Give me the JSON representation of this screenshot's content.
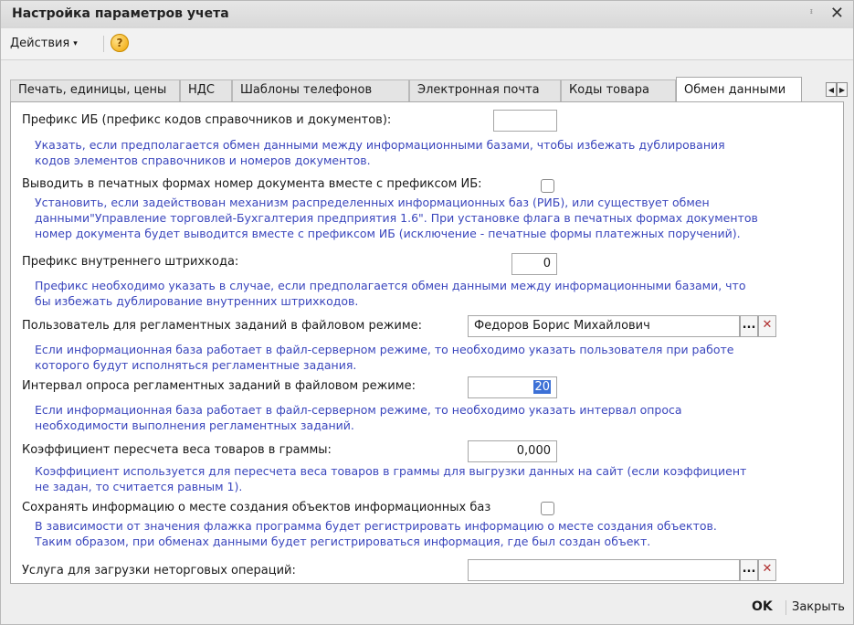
{
  "window": {
    "title": "Настройка параметров учета",
    "pin_glyph": "ᵻ",
    "close_glyph": "✕"
  },
  "menu": {
    "actions_label": "Действия",
    "actions_caret": "▾",
    "help_glyph": "?"
  },
  "tabs": [
    {
      "label": "Печать, единицы, цены",
      "active": false
    },
    {
      "label": "НДС",
      "active": false
    },
    {
      "label": "Шаблоны телефонов",
      "active": false
    },
    {
      "label": "Электронная почта",
      "active": false
    },
    {
      "label": "Коды товара",
      "active": false
    },
    {
      "label": "Обмен данными",
      "active": true
    }
  ],
  "tab_scroll": {
    "left": "◀",
    "right": "▶"
  },
  "fields": {
    "prefix_ib": {
      "label": "Префикс ИБ (префикс кодов справочников и документов):",
      "value": "",
      "hint1": "Указать, если предполагается обмен данными между информационными базами, чтобы избежать дублирования",
      "hint2": "кодов элементов справочников и номеров документов."
    },
    "print_prefix": {
      "label": "Выводить в печатных формах номер документа вместе с префиксом ИБ:",
      "checked": false,
      "hint1": "Установить, если задействован механизм распределенных информационных баз (РИБ), или существует обмен",
      "hint2": "данными\"Управление торговлей-Бухгалтерия предприятия 1.6\". При установке флага в печатных формах документов",
      "hint3": "номер документа будет выводится вместе с префиксом ИБ (исключение - печатные формы платежных поручений)."
    },
    "barcode_prefix": {
      "label": "Префикс внутреннего штрихкода:",
      "value": "0",
      "hint1": "Префикс необходимо указать в случае, если предполагается обмен данными между информационными базами, что",
      "hint2": "бы избежать дублирование внутренних штрихкодов."
    },
    "task_user": {
      "label": "Пользователь для регламентных заданий в файловом режиме:",
      "value": "Федоров Борис Михайлович",
      "select_glyph": "...",
      "clear_glyph": "✕",
      "hint1": "Если информационная база работает в файл-серверном режиме, то необходимо указать пользователя при работе",
      "hint2": "которого будут исполняться регламентные задания."
    },
    "poll_interval": {
      "label": "Интервал опроса регламентных заданий в файловом режиме:",
      "value": "20",
      "hint1": "Если информационная база работает в файл-серверном режиме, то необходимо указать интервал опроса",
      "hint2": "необходимости выполнения регламентных заданий."
    },
    "weight_coef": {
      "label": "Коэффициент пересчета веса товаров в граммы:",
      "value": "0,000",
      "hint1": "Коэффициент используется для пересчета веса товаров в граммы для выгрузки данных на сайт (если коэффициент",
      "hint2": "не задан, то считается равным 1)."
    },
    "save_origin": {
      "label": "Сохранять информацию о месте создания объектов информационных баз",
      "checked": false,
      "hint1": "В зависимости от значения флажка программа будет регистрировать информацию о месте создания объектов.",
      "hint2": "Таким образом, при обменах данными будет регистрироваться информация, где был создан объект."
    },
    "nontrade_service": {
      "label": "Услуга для загрузки неторговых операций:",
      "value": "",
      "select_glyph": "...",
      "clear_glyph": "✕"
    }
  },
  "footer": {
    "ok_label": "OK",
    "close_label": "Закрыть"
  }
}
